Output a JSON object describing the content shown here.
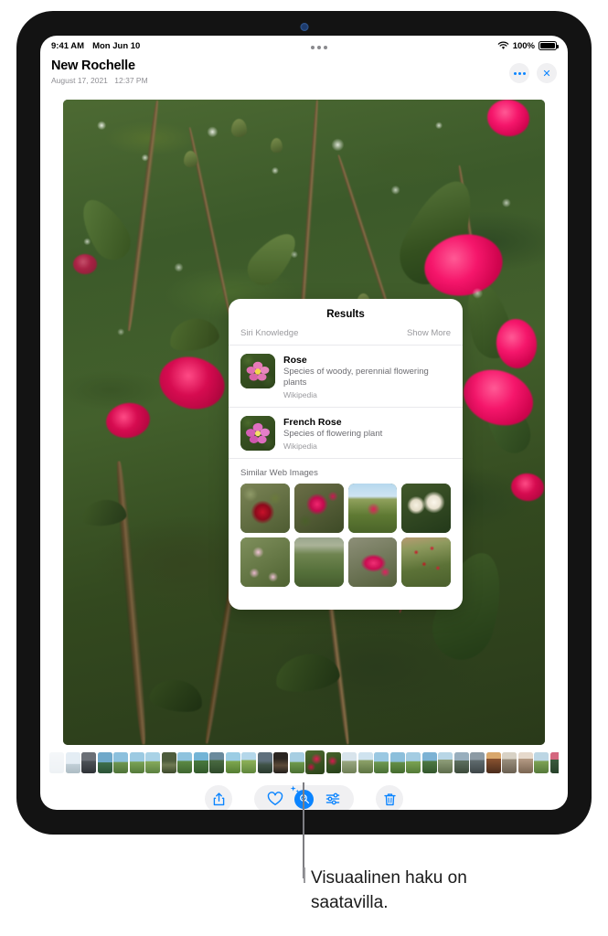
{
  "statusbar": {
    "time": "9:41 AM",
    "date": "Mon Jun 10",
    "wifi_icon": "wifi-icon",
    "battery_percent": "100%",
    "battery_icon": "battery-icon",
    "multitask_icon": "multitask-handle-icon"
  },
  "navbar": {
    "title": "New Rochelle",
    "date": "August 17, 2021",
    "time": "12:37 PM",
    "more_icon": "ellipsis-icon",
    "close_icon": "close-icon",
    "more_label": "",
    "close_label": "✕"
  },
  "photo": {
    "name": "rose-bush-photo",
    "alt": "Close-up of a rose bush with deep pink roses and green foliage"
  },
  "results": {
    "title": "Results",
    "section_label": "Siri Knowledge",
    "show_more": "Show More",
    "knowledge": [
      {
        "name": "Rose",
        "description": "Species of woody, perennial flowering plants",
        "source": "Wikipedia",
        "thumb_icon": "pink-rose-thumb"
      },
      {
        "name": "French Rose",
        "description": "Species of flowering plant",
        "source": "Wikipedia",
        "thumb_icon": "pink-rose-thumb"
      }
    ],
    "similar_label": "Similar Web Images",
    "similar_images": [
      {
        "name": "red-rose-bloom"
      },
      {
        "name": "magenta-rose-bush"
      },
      {
        "name": "rose-field-with-sky"
      },
      {
        "name": "white-roses"
      },
      {
        "name": "pale-pink-roses"
      },
      {
        "name": "rose-nursery-row"
      },
      {
        "name": "pink-rose-buds"
      },
      {
        "name": "red-rose-shrub-with-label"
      }
    ]
  },
  "toolbar": {
    "share_label": "share-icon",
    "favorite_label": "heart-icon",
    "visual_lookup_label": "visual-lookup-icon",
    "adjust_label": "adjust-sliders-icon",
    "delete_label": "trash-icon",
    "accent_color": "#0a84ff",
    "pill_background": "#f0f0f2"
  },
  "filmstrip": {
    "name": "photo-filmstrip",
    "selected_index": 17,
    "count": 34
  },
  "callout": {
    "text_line_1": "Visuaalinen haku on",
    "text_line_2": "saatavilla.",
    "text": "Visuaalinen haku on saatavilla."
  }
}
